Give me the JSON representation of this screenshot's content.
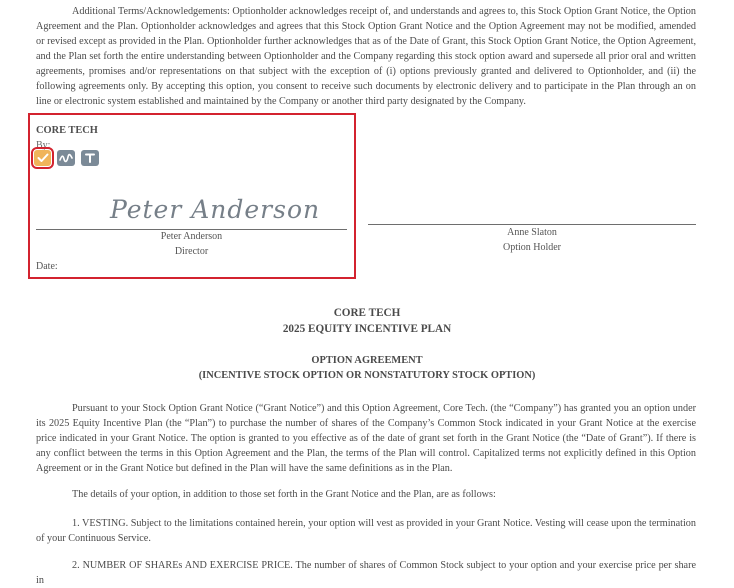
{
  "ack_paragraph": "Additional Terms/Acknowledgements: Optionholder acknowledges receipt of, and understands and agrees to, this Stock Option Grant Notice, the Option Agreement and the Plan. Optionholder acknowledges and agrees that this Stock Option Grant Notice and the Option Agreement may not be modified, amended or revised except as provided in the Plan. Optionholder further acknowledges that as of the Date of Grant, this Stock Option Grant Notice, the Option Agreement, and the Plan set forth the entire understanding between Optionholder and the Company regarding this stock option award and supersede all prior oral and written agreements, promises and/or representations on that subject with the exception of (i) options previously granted and delivered to Optionholder, and (ii) the following agreements only. By accepting this option, you consent to receive such documents by electronic delivery and to participate in the Plan through an on line or electronic system established and maintained by the Company or another third party designated by the Company.",
  "company_signature": {
    "company": "CORE TECH",
    "by_label": "By:",
    "tools": [
      {
        "icon": "check-icon",
        "active": true
      },
      {
        "icon": "draw-signature-icon",
        "active": false
      },
      {
        "icon": "text-icon",
        "active": false
      }
    ],
    "signature_script": "Peter Anderson",
    "name": "Peter Anderson",
    "title": "Director",
    "date_label": "Date:"
  },
  "holder_signature": {
    "name": "Anne Slaton",
    "role": "Option Holder"
  },
  "headings": {
    "company": "CORE TECH",
    "plan": "2025 EQUITY INCENTIVE PLAN",
    "agreement": "OPTION AGREEMENT",
    "subtitle": "(INCENTIVE STOCK OPTION OR NONSTATUTORY STOCK OPTION)"
  },
  "pursuant_paragraph": "Pursuant to your Stock Option Grant Notice (“Grant Notice”) and this Option Agreement, Core Tech. (the “Company”) has granted you an option under its 2025 Equity Incentive Plan (the “Plan”) to purchase the number of shares of the Company’s Common Stock indicated in your Grant Notice at the exercise price indicated in your Grant Notice. The option is granted to you effective as of the date of grant set forth in the Grant Notice (the “Date of Grant”). If there is any conflict between the terms in this Option Agreement and the Plan, the terms of the Plan will control. Capitalized terms not explicitly defined in this Option Agreement or in the Grant Notice but defined in the Plan will have the same definitions as in the Plan.",
  "details_paragraph": "The details of your option, in addition to those set forth in the Grant Notice and the Plan, are as follows:",
  "vesting_paragraph": "1. VESTING. Subject to the limitations contained herein, your option will vest as provided in your Grant Notice. Vesting will cease upon the termination of your Continuous Service.",
  "shares_paragraph": "2. NUMBER OF SHAREs AND EXERCISE PRICE. The number of shares of Common Stock subject to your option and your exercise price per share in"
}
